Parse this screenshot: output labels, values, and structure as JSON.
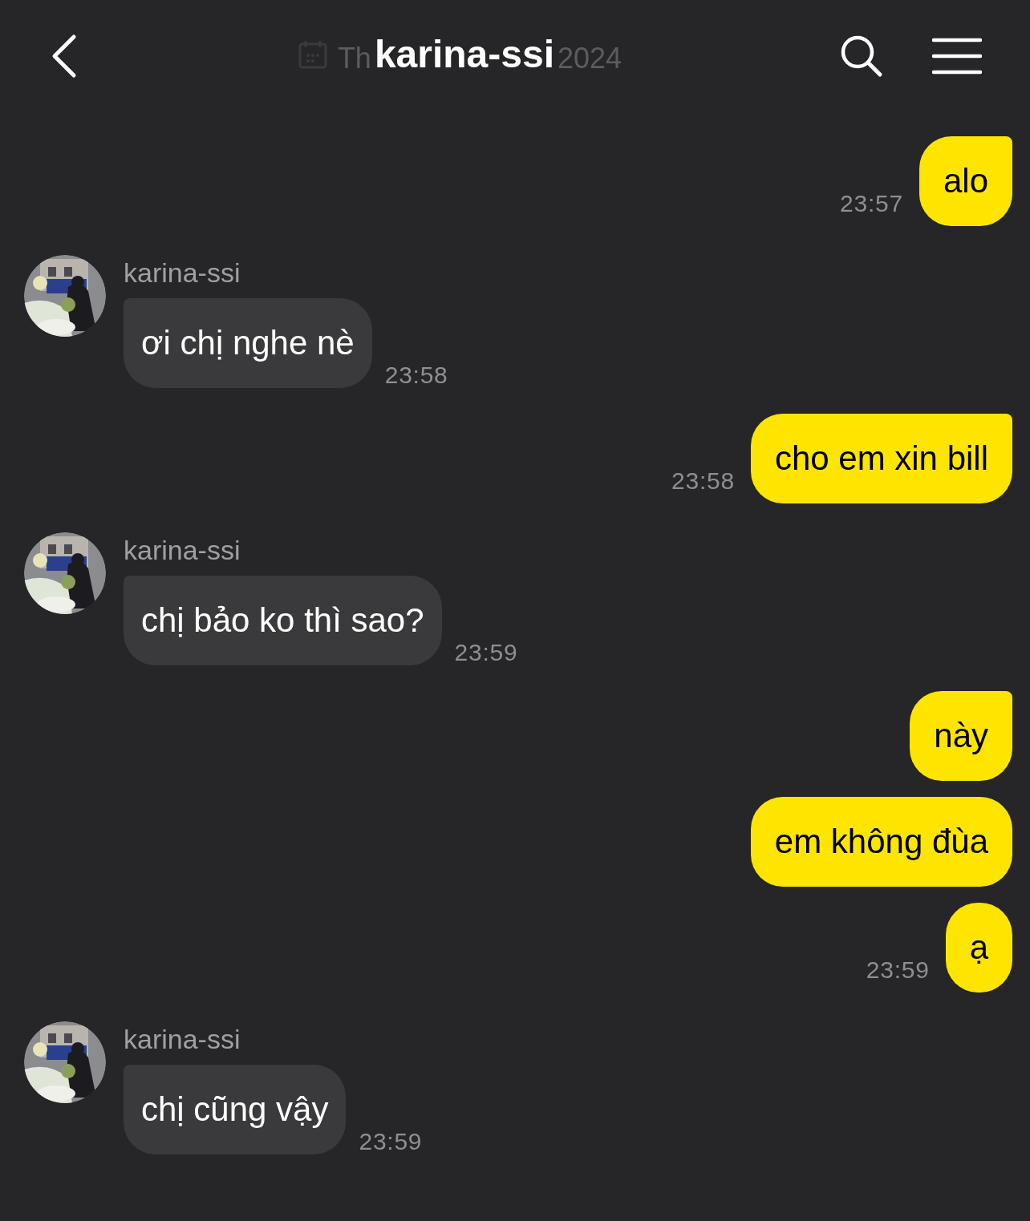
{
  "header": {
    "title": "karina-ssi",
    "date_banner": {
      "visible_start": "Th",
      "visible_end": "2024"
    }
  },
  "messages": [
    {
      "kind": "sent",
      "text": "alo",
      "time": "23:57"
    },
    {
      "kind": "received",
      "sender": "karina-ssi",
      "text": "ơi chị nghe nè",
      "time": "23:58"
    },
    {
      "kind": "sent",
      "text": "cho em xin bill",
      "time": "23:58"
    },
    {
      "kind": "received",
      "sender": "karina-ssi",
      "text": "chị bảo ko thì sao?",
      "time": "23:59"
    },
    {
      "kind": "sent",
      "text": "này"
    },
    {
      "kind": "sent",
      "text": "em không đùa"
    },
    {
      "kind": "sent",
      "text": "ạ",
      "time": "23:59"
    },
    {
      "kind": "received",
      "sender": "karina-ssi",
      "text": "chị cũng vậy",
      "time": "23:59"
    }
  ]
}
